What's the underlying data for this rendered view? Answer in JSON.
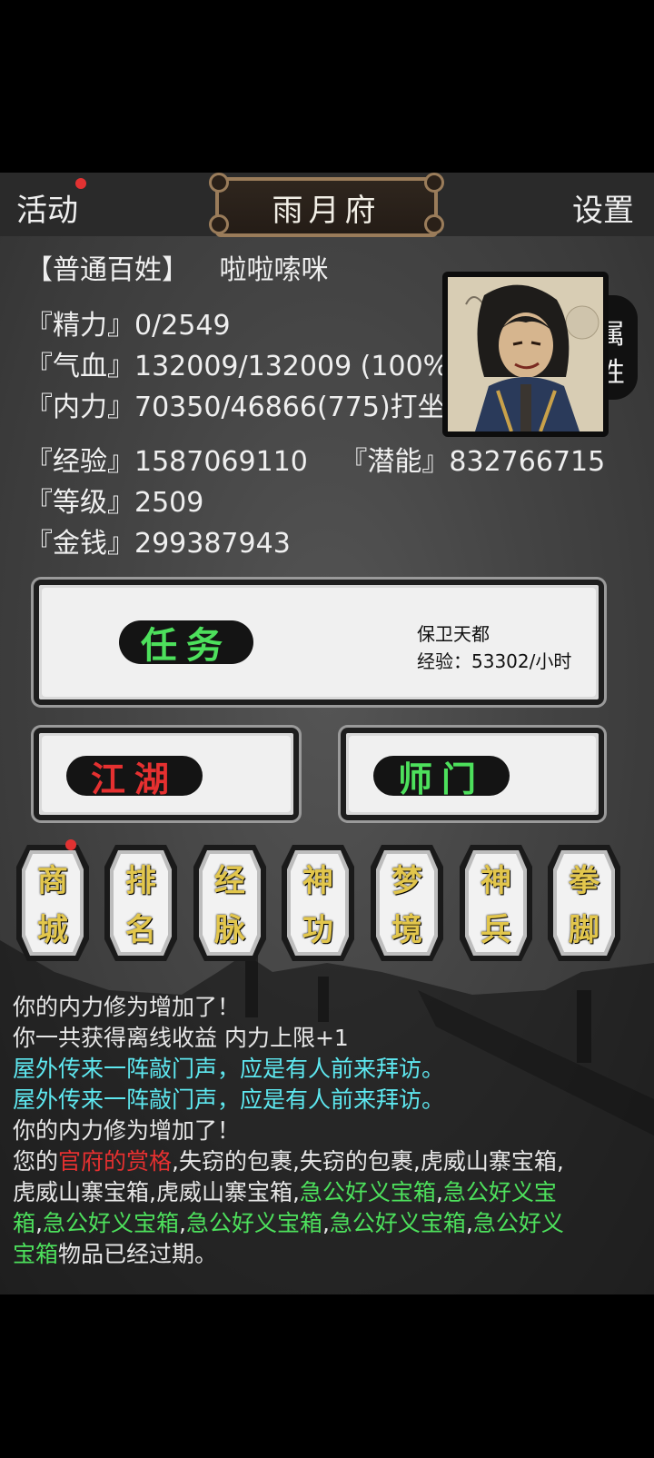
{
  "header": {
    "left_label": "活动",
    "title": "雨月府",
    "right_label": "设置"
  },
  "player": {
    "rank": "【普通百姓】",
    "name": "啦啦嗦咪",
    "energy": "『精力』0/2549",
    "hp": "『气血』132009/132009 (100%",
    "internal": "『内力』70350/46866(775)打坐",
    "exp": "『经验』1587069110",
    "potential": "『潜能』832766715",
    "level": "『等级』2509",
    "money": "『金钱』299387943"
  },
  "portrait_tab": {
    "line1": "属",
    "line2": "性"
  },
  "task": {
    "button_label": "任务",
    "detail_line1": "保卫天都",
    "detail_line2": "经验：53302/小时"
  },
  "secondary_buttons": [
    {
      "label": "江湖",
      "color": "#e53030"
    },
    {
      "label": "师门",
      "color": "#4de05c"
    }
  ],
  "hex_buttons": [
    {
      "top": "商",
      "bottom": "城",
      "badge": true
    },
    {
      "top": "排",
      "bottom": "名",
      "badge": false
    },
    {
      "top": "经",
      "bottom": "脉",
      "badge": false
    },
    {
      "top": "神",
      "bottom": "功",
      "badge": false
    },
    {
      "top": "梦",
      "bottom": "境",
      "badge": false
    },
    {
      "top": "神",
      "bottom": "兵",
      "badge": false
    },
    {
      "top": "拳",
      "bottom": "脚",
      "badge": false
    }
  ],
  "log": {
    "l1": "你的内力修为增加了！",
    "l2": "你一共获得离线收益 内力上限+1",
    "l3": "屋外传来一阵敲门声，应是有人前来拜访。",
    "l4": "屋外传来一阵敲门声，应是有人前来拜访。",
    "l5": "你的内力修为增加了！",
    "l6a": "您的",
    "l6b": "官府的赏格",
    "l6c": ",失窃的包裹,失窃的包裹,虎威山寨宝箱,",
    "l7a": "虎威山寨宝箱,虎威山寨宝箱,",
    "l7b": "急公好义宝箱",
    "l7c": ",",
    "l7d": "急公好义宝",
    "l8a": "箱",
    "l8b": ",",
    "l8c": "急公好义宝箱",
    "l8d": ",",
    "l8e": "急公好义宝箱",
    "l8f": ",",
    "l8g": "急公好义宝箱",
    "l8h": ",",
    "l8i": "急公好义",
    "l9a": "宝箱",
    "l9b": "物品已经过期。"
  },
  "colors": {
    "accent_gold": "#e2c64c",
    "cyan": "#5ee8f0",
    "green": "#4de05c",
    "red": "#e53030",
    "frame": "#9a7c5a"
  }
}
